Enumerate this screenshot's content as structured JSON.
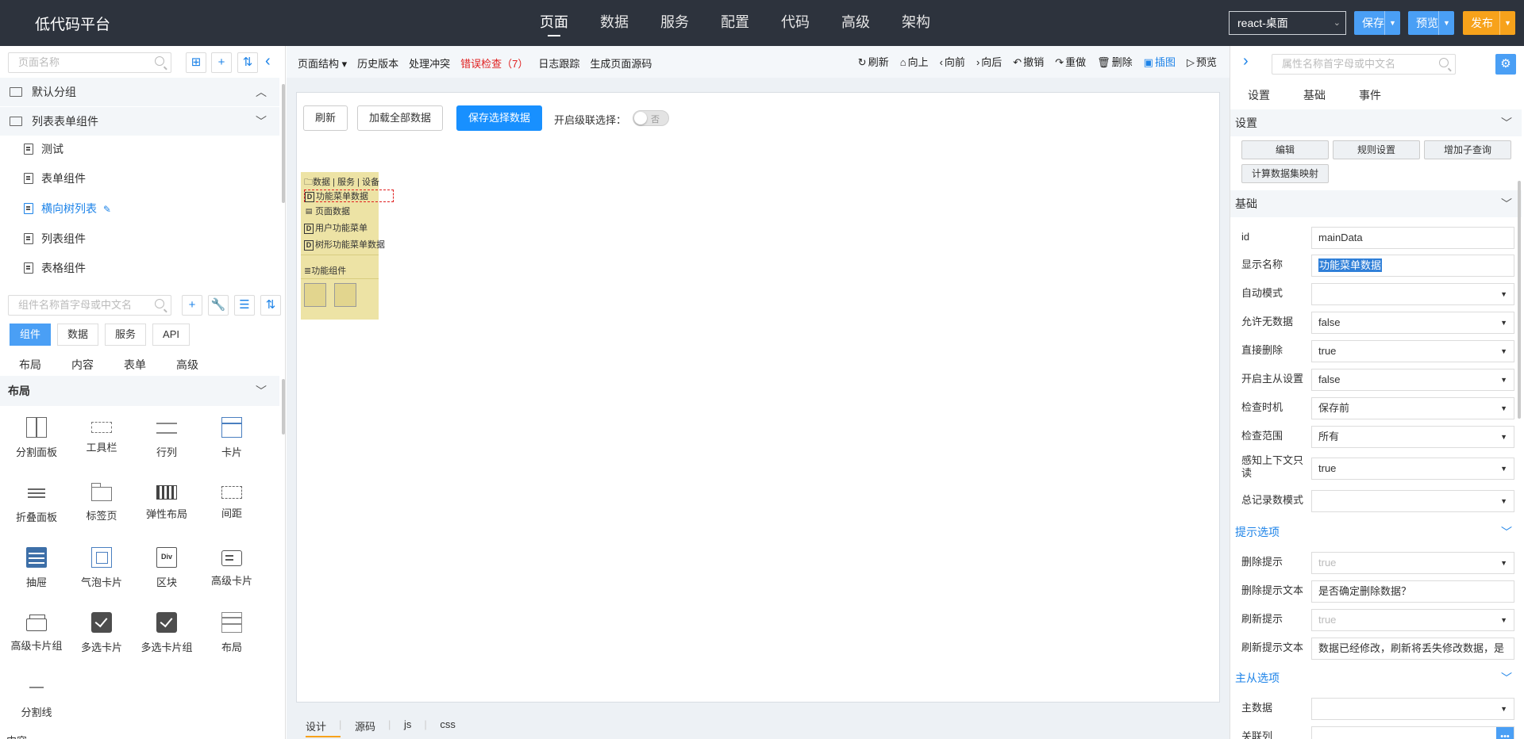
{
  "app": {
    "brand": "低代码平台"
  },
  "nav": {
    "items": [
      "页面",
      "数据",
      "服务",
      "配置",
      "代码",
      "高级",
      "架构"
    ],
    "active": "页面"
  },
  "topbar": {
    "env": "react-桌面",
    "save": "保存",
    "preview": "预览",
    "publish": "发布",
    "colors": {
      "primary": "#4a9ff5",
      "publish": "#f7a21b",
      "bar": "#2d333d"
    }
  },
  "left": {
    "page_search_placeholder": "页面名称",
    "groups": [
      {
        "name": "默认分组",
        "expanded": false
      },
      {
        "name": "列表表单组件",
        "expanded": true
      }
    ],
    "pages": [
      "测试",
      "表单组件",
      "横向树列表",
      "列表组件",
      "表格组件"
    ],
    "active_page": "横向树列表",
    "comp_search_placeholder": "组件名称首字母或中文名",
    "tabs": [
      "组件",
      "数据",
      "服务",
      "API"
    ],
    "active_tab": "组件",
    "subtabs": [
      "布局",
      "内容",
      "表单",
      "高级"
    ],
    "section": "布局",
    "components": [
      "分割面板",
      "工具栏",
      "行列",
      "卡片",
      "折叠面板",
      "标签页",
      "弹性布局",
      "间距",
      "抽屉",
      "气泡卡片",
      "区块",
      "高级卡片",
      "高级卡片组",
      "多选卡片",
      "多选卡片组",
      "布局",
      "分割线"
    ],
    "next_section_cut": "内容",
    "div_glyph": "Div"
  },
  "center": {
    "toolbar_left": [
      "页面结构 ▾",
      "历史版本",
      "处理冲突",
      "错误检查（7）",
      "日志跟踪",
      "生成页面源码"
    ],
    "toolbar_right": [
      {
        "icon": "↻",
        "label": "刷新"
      },
      {
        "icon": "⌂",
        "label": "向上"
      },
      {
        "icon": "‹",
        "label": "向前"
      },
      {
        "icon": "›",
        "label": "向后"
      },
      {
        "icon": "↶",
        "label": "撤销"
      },
      {
        "icon": "↷",
        "label": "重做"
      },
      {
        "icon": "🗑",
        "label": "删除"
      },
      {
        "icon": "▣",
        "label": "插图"
      },
      {
        "icon": "▷",
        "label": "预览"
      }
    ],
    "canvas": {
      "refresh": "刷新",
      "load_all": "加载全部数据",
      "save_selected": "保存选择数据",
      "cascade_label": "开启级联选择：",
      "toggle_text": "否",
      "data_header": "数据 | 服务 | 设备",
      "data_items": [
        "功能菜单数据",
        "页面数据",
        "用户功能菜单",
        "树形功能菜单数据"
      ],
      "data_icons": [
        "D",
        "▤",
        "D",
        "D"
      ],
      "func_header": "功能组件"
    },
    "bottom_tabs": [
      "设计",
      "源码",
      "js",
      "css"
    ],
    "active_bottom_tab": "设计"
  },
  "right": {
    "search_placeholder": "属性名称首字母或中文名",
    "tabs": [
      "设置",
      "基础",
      "事件"
    ],
    "settings_title": "设置",
    "settings_buttons": [
      "编辑",
      "规则设置",
      "增加子查询",
      "计算数据集映射"
    ],
    "base_title": "基础",
    "props": [
      {
        "label": "id",
        "value": "mainData",
        "type": "text"
      },
      {
        "label": "显示名称",
        "value": "功能菜单数据",
        "type": "text",
        "selected": true
      },
      {
        "label": "自动模式",
        "value": "",
        "type": "select"
      },
      {
        "label": "允许无数据",
        "value": "false",
        "type": "select"
      },
      {
        "label": "直接删除",
        "value": "true",
        "type": "select"
      },
      {
        "label": "开启主从设置",
        "value": "false",
        "type": "select"
      },
      {
        "label": "检查时机",
        "value": "保存前",
        "type": "select"
      },
      {
        "label": "检查范围",
        "value": "所有",
        "type": "select"
      },
      {
        "label": "感知上下文只读",
        "value": "true",
        "type": "select",
        "two_line": true
      },
      {
        "label": "总记录数模式",
        "value": "",
        "type": "select"
      }
    ],
    "hint_title": "提示选项",
    "hint_props": [
      {
        "label": "删除提示",
        "value": "true",
        "type": "select",
        "placeholder": true
      },
      {
        "label": "删除提示文本",
        "value": "是否确定删除数据？",
        "type": "text"
      },
      {
        "label": "刷新提示",
        "value": "true",
        "type": "select",
        "placeholder": true
      },
      {
        "label": "刷新提示文本",
        "value": "数据已经修改，刷新将丢失修改数据，是",
        "type": "text"
      }
    ],
    "master_title": "主从选项",
    "master_props": [
      {
        "label": "主数据",
        "value": "",
        "type": "select"
      },
      {
        "label": "关联列",
        "value": "",
        "type": "dots"
      }
    ]
  }
}
